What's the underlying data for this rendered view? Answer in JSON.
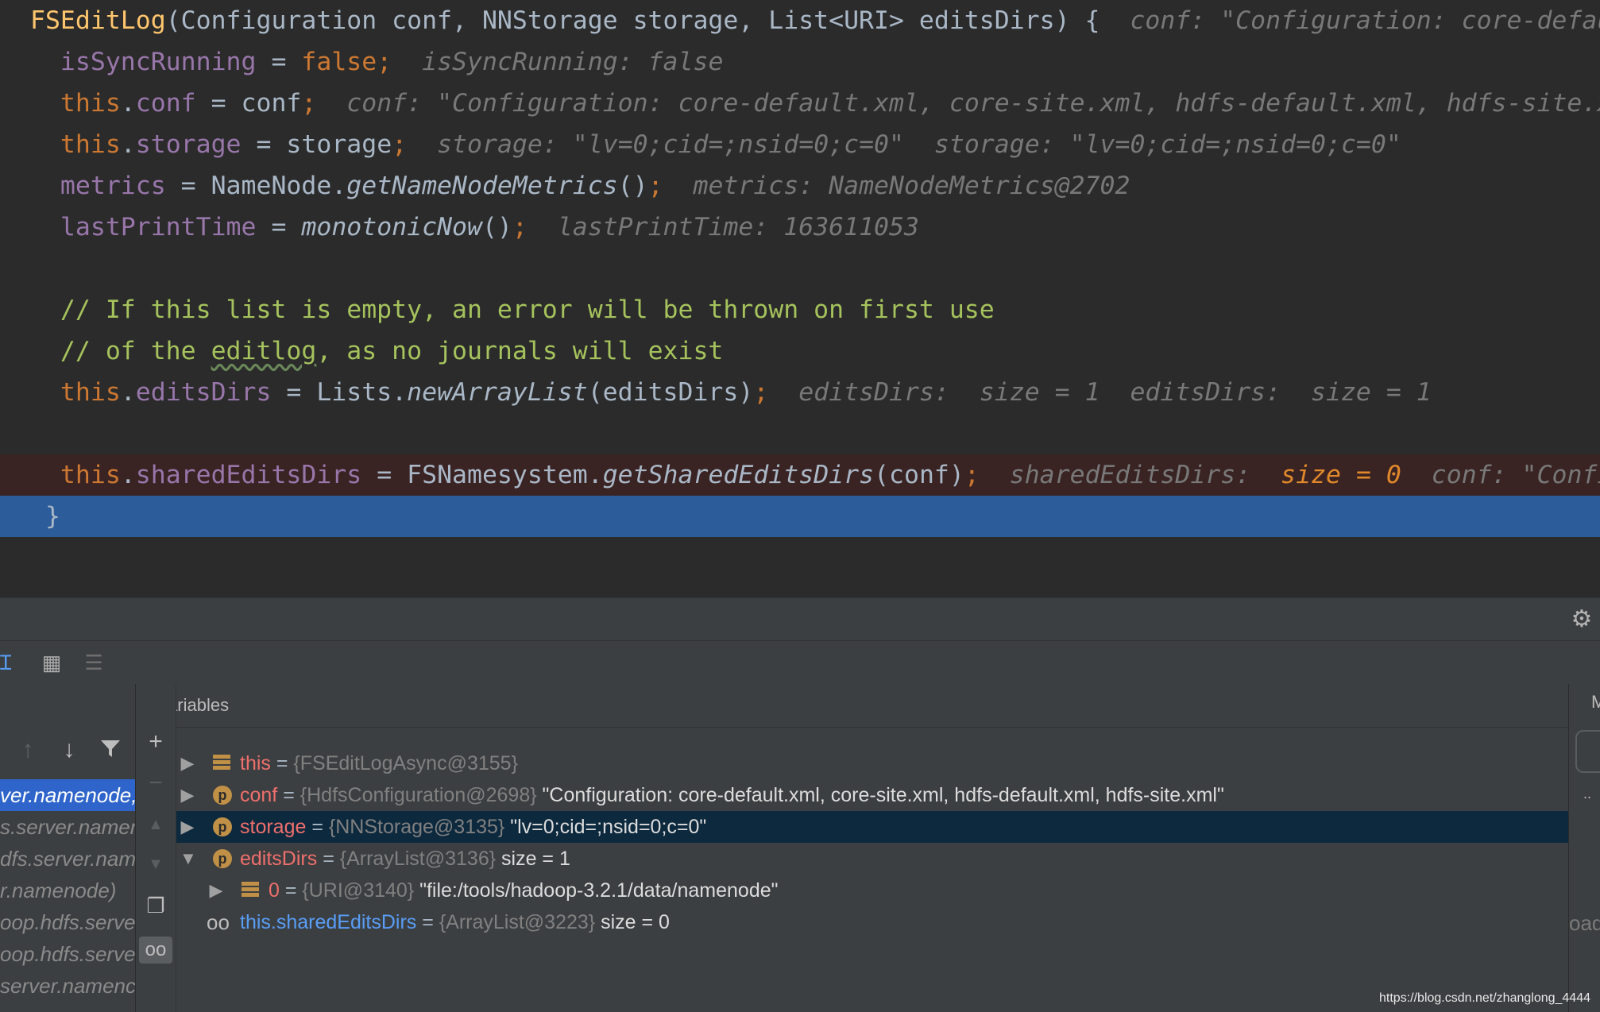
{
  "editor": {
    "lines": [
      {
        "segs": [
          [
            "hdr",
            "FSEditLog"
          ],
          [
            "plain",
            "(Configuration conf, NNStorage storage, List<URI> editsDirs) {  "
          ],
          [
            "hint",
            "conf: \"Configuration: core-default.xml, core-site.xml, hdfs-default.xml, hdfs-site.xml\""
          ]
        ]
      },
      {
        "segs": [
          [
            "fld",
            "  isSyncRunning"
          ],
          [
            "plain",
            " = "
          ],
          [
            "kw",
            "false;"
          ],
          [
            "hint",
            "  isSyncRunning: false"
          ]
        ]
      },
      {
        "segs": [
          [
            "kw",
            "  this"
          ],
          [
            "plain",
            "."
          ],
          [
            "fld",
            "conf"
          ],
          [
            "plain",
            " = conf"
          ],
          [
            "kw",
            ";"
          ],
          [
            "hint",
            "  conf: \"Configuration: core-default.xml, core-site.xml, hdfs-default.xml, hdfs-site.xml\""
          ]
        ]
      },
      {
        "segs": [
          [
            "kw",
            "  this"
          ],
          [
            "plain",
            "."
          ],
          [
            "fld",
            "storage"
          ],
          [
            "plain",
            " = storage"
          ],
          [
            "kw",
            ";"
          ],
          [
            "hint",
            "  storage: \"lv=0;cid=;nsid=0;c=0\"  storage: \"lv=0;cid=;nsid=0;c=0\""
          ]
        ]
      },
      {
        "segs": [
          [
            "fld",
            "  metrics"
          ],
          [
            "plain",
            " = NameNode."
          ],
          [
            "ital",
            "getNameNodeMetrics"
          ],
          [
            "plain",
            "()"
          ],
          [
            "kw",
            ";"
          ],
          [
            "hint",
            "  metrics: NameNodeMetrics@2702"
          ]
        ]
      },
      {
        "segs": [
          [
            "fld",
            "  lastPrintTime"
          ],
          [
            "plain",
            " = "
          ],
          [
            "ital",
            "monotonicNow"
          ],
          [
            "plain",
            "()"
          ],
          [
            "kw",
            ";"
          ],
          [
            "hint",
            "  lastPrintTime: 163611053"
          ]
        ]
      },
      {
        "segs": []
      },
      {
        "segs": [
          [
            "cmt",
            "  // If this list is empty, an error will be thrown on first use"
          ]
        ]
      },
      {
        "segs": [
          [
            "cmt",
            "  // of the "
          ],
          [
            "cmt typo",
            "editlog"
          ],
          [
            "cmt",
            ", as no journals will exist"
          ]
        ]
      },
      {
        "segs": [
          [
            "kw",
            "  this"
          ],
          [
            "plain",
            "."
          ],
          [
            "fld",
            "editsDirs"
          ],
          [
            "plain",
            " = Lists."
          ],
          [
            "ital",
            "newArrayList"
          ],
          [
            "plain",
            "(editsDirs)"
          ],
          [
            "kw",
            ";"
          ],
          [
            "hint",
            "  editsDirs:  size = 1  editsDirs:  size = 1"
          ]
        ]
      },
      {
        "segs": []
      },
      {
        "segs": [
          [
            "kw",
            "  this"
          ],
          [
            "plain",
            "."
          ],
          [
            "fld",
            "sharedEditsDirs"
          ],
          [
            "plain",
            " = FSNamesystem."
          ],
          [
            "ital",
            "getSharedEditsDirs"
          ],
          [
            "plain",
            "(conf)"
          ],
          [
            "kw",
            ";"
          ],
          [
            "hint",
            "  sharedEditsDirs:  "
          ],
          [
            "hint-hi",
            "size = 0"
          ],
          [
            "hint",
            "  conf: \"Configuration: core-default.xml, core-site.xml, hdfs-default.xml, hdfs-site.xml\""
          ]
        ]
      },
      {
        "segs": [
          [
            "plain",
            " }"
          ]
        ]
      }
    ]
  },
  "frames": {
    "items": [
      {
        "label": "ver.namenode,",
        "selected": true
      },
      {
        "label": "s.server.namen",
        "selected": false
      },
      {
        "label": "dfs.server.nam",
        "selected": false
      },
      {
        "label": "r.namenode)",
        "selected": false
      },
      {
        "label": "oop.hdfs.serve",
        "selected": false
      },
      {
        "label": "oop.hdfs.serve",
        "selected": false
      },
      {
        "label": "server.namenc",
        "selected": false
      }
    ]
  },
  "variables": {
    "title": "Variables",
    "rows": [
      {
        "name": "this",
        "eq": " = ",
        "type": "{FSEditLogAsync@3155}",
        "value": "",
        "icon": "lines",
        "arrow": "▶",
        "indent": 0
      },
      {
        "name": "conf",
        "eq": " = ",
        "type": "{HdfsConfiguration@2698}",
        "value": " \"Configuration: core-default.xml, core-site.xml, hdfs-default.xml, hdfs-site.xml\"",
        "icon": "p",
        "arrow": "▶",
        "indent": 0
      },
      {
        "name": "storage",
        "eq": " = ",
        "type": "{NNStorage@3135}",
        "value": " \"lv=0;cid=;nsid=0;c=0\"",
        "icon": "p",
        "arrow": "▶",
        "indent": 0,
        "selected": true
      },
      {
        "name": "editsDirs",
        "eq": " = ",
        "type": "{ArrayList@3136}",
        "value": "  size = 1",
        "icon": "p",
        "arrow": "▼",
        "indent": 0
      },
      {
        "name": "0",
        "eq": " = ",
        "type": "{URI@3140}",
        "value": " \"file:/tools/hadoop-3.2.1/data/namenode\"",
        "icon": "lines",
        "arrow": "▶",
        "indent": 1
      },
      {
        "name": "this.sharedEditsDirs",
        "eq": " = ",
        "type": "{ArrayList@3223}",
        "value": "  size = 0",
        "icon": "watch",
        "arrow": "",
        "indent": 0
      }
    ]
  },
  "right_pane": {
    "top_label": "M",
    "side_label": "oad",
    "dots": ".."
  },
  "watermark": "https://blog.csdn.net/zhanglong_4444"
}
